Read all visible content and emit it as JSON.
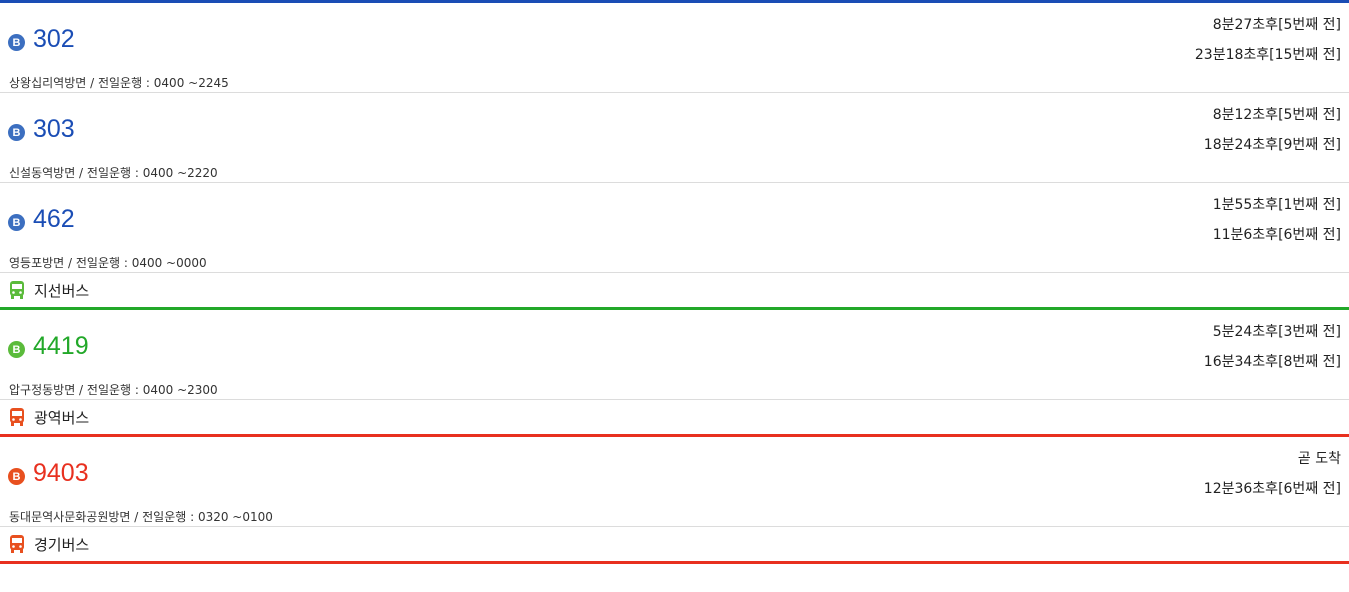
{
  "colors": {
    "trunk": "#1a4db5",
    "branch": "#22a829",
    "express": "#e8301f",
    "badge_trunk": "#3c6fc0",
    "badge_branch": "#5bbb3b",
    "badge_express": "#e8501f"
  },
  "groups": [
    {
      "type_label": "",
      "color_key": "trunk",
      "routes": [
        {
          "badge": "B",
          "number": "302",
          "direction_info": "상왕십리역방면 / 전일운행 : 0400 ~2245",
          "arrival_1": "8분27초후[5번째 전]",
          "arrival_2": "23분18초후[15번째 전]"
        },
        {
          "badge": "B",
          "number": "303",
          "direction_info": "신설동역방면 / 전일운행 : 0400 ~2220",
          "arrival_1": "8분12초후[5번째 전]",
          "arrival_2": "18분24초후[9번째 전]"
        },
        {
          "badge": "B",
          "number": "462",
          "direction_info": "영등포방면 / 전일운행 : 0400 ~0000",
          "arrival_1": "1분55초후[1번째 전]",
          "arrival_2": "11분6초후[6번째 전]"
        }
      ]
    },
    {
      "type_label": "지선버스",
      "color_key": "branch",
      "routes": [
        {
          "badge": "B",
          "number": "4419",
          "direction_info": "압구정동방면 / 전일운행 : 0400 ~2300",
          "arrival_1": "5분24초후[3번째 전]",
          "arrival_2": "16분34초후[8번째 전]"
        }
      ]
    },
    {
      "type_label": "광역버스",
      "color_key": "express",
      "routes": [
        {
          "badge": "B",
          "number": "9403",
          "direction_info": "동대문역사문화공원방면 / 전일운행 : 0320 ~0100",
          "arrival_1": "곧 도착",
          "arrival_2": "12분36초후[6번째 전]"
        }
      ]
    },
    {
      "type_label": "경기버스",
      "color_key": "express",
      "routes": []
    }
  ]
}
